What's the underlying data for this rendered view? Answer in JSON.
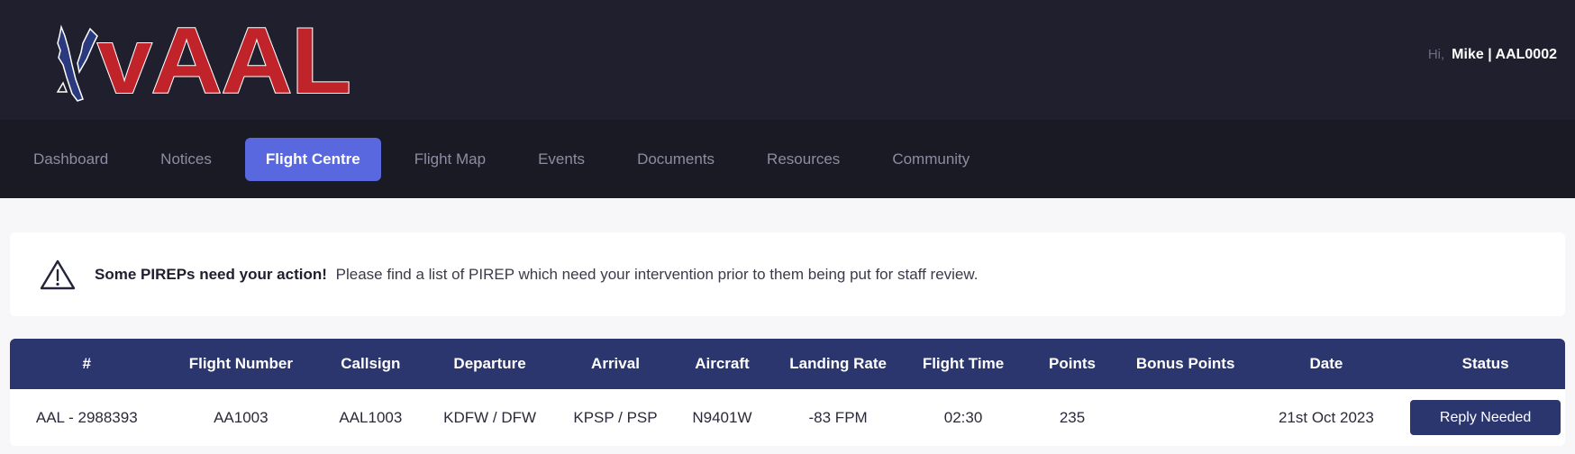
{
  "header": {
    "logo_text": "vAAL",
    "greeting_prefix": "Hi,",
    "user_label": "Mike | AAL0002",
    "colors": {
      "logo_red": "#c0232a",
      "logo_blue": "#2b3a7e",
      "header_bg": "#201f2e"
    }
  },
  "nav": {
    "items": [
      {
        "label": "Dashboard",
        "active": false
      },
      {
        "label": "Notices",
        "active": false
      },
      {
        "label": "Flight Centre",
        "active": true
      },
      {
        "label": "Flight Map",
        "active": false
      },
      {
        "label": "Events",
        "active": false
      },
      {
        "label": "Documents",
        "active": false
      },
      {
        "label": "Resources",
        "active": false
      },
      {
        "label": "Community",
        "active": false
      }
    ],
    "active_color": "#5a68e0"
  },
  "alert": {
    "icon": "warning-triangle-icon",
    "title": "Some PIREPs need your action!",
    "message": "Please find a list of PIREP which need your intervention prior to them being put for staff review."
  },
  "table": {
    "header_color": "#2b366e",
    "columns": [
      "#",
      "Flight Number",
      "Callsign",
      "Departure",
      "Arrival",
      "Aircraft",
      "Landing Rate",
      "Flight Time",
      "Points",
      "Bonus Points",
      "Date",
      "Status"
    ],
    "rows": [
      {
        "id": "AAL - 2988393",
        "flight_number": "AA1003",
        "callsign": "AAL1003",
        "departure": "KDFW / DFW",
        "arrival": "KPSP / PSP",
        "aircraft": "N9401W",
        "landing_rate": "-83 FPM",
        "flight_time": "02:30",
        "points": "235",
        "bonus_points": "",
        "date": "21st Oct 2023",
        "status": "Reply Needed"
      }
    ]
  }
}
